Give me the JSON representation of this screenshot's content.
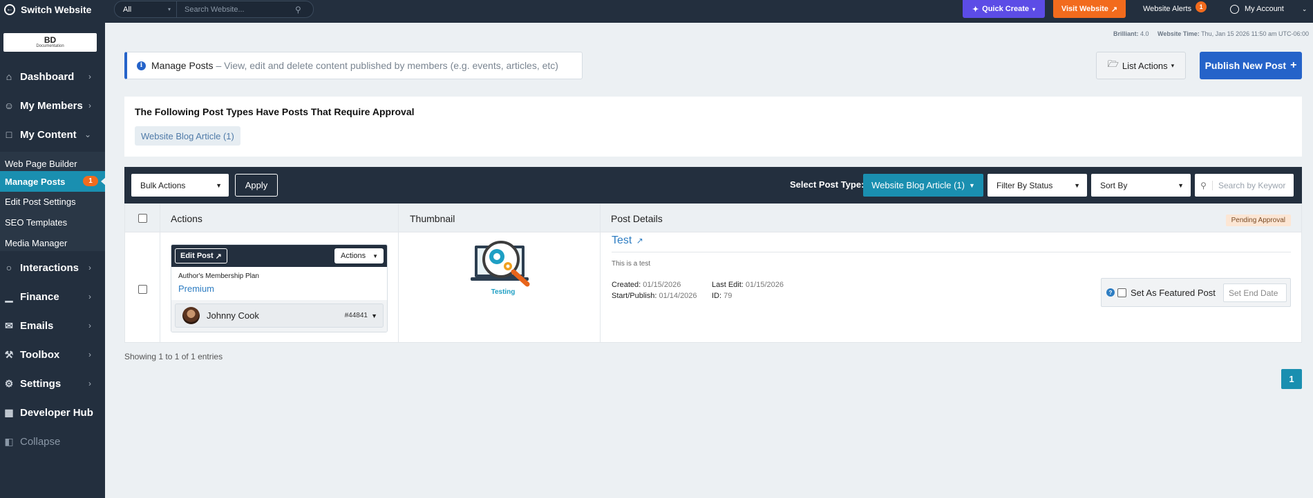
{
  "topbar": {
    "switch_label": "Switch Website",
    "search_scope": "All",
    "search_placeholder": "Search Website...",
    "quick_create": "Quick Create",
    "visit_website": "Visit Website",
    "alerts_label": "Website Alerts",
    "alerts_count": "1",
    "account_label": "My Account"
  },
  "logo": {
    "text": "BD",
    "subtext": "Documentation"
  },
  "sidebar": {
    "items": [
      {
        "label": "Dashboard",
        "icon": "home-icon"
      },
      {
        "label": "My Members",
        "icon": "users-icon"
      },
      {
        "label": "My Content",
        "icon": "folder-icon"
      },
      {
        "label": "Interactions",
        "icon": "chat-icon"
      },
      {
        "label": "Finance",
        "icon": "bar-chart-icon"
      },
      {
        "label": "Emails",
        "icon": "envelope-icon"
      },
      {
        "label": "Toolbox",
        "icon": "wrench-icon"
      },
      {
        "label": "Settings",
        "icon": "gear-icon"
      },
      {
        "label": "Developer Hub",
        "icon": "grid-icon"
      },
      {
        "label": "Collapse",
        "icon": "collapse-icon"
      }
    ],
    "subitems": [
      {
        "label": "Web Page Builder"
      },
      {
        "label": "Manage Posts",
        "badge": "1"
      },
      {
        "label": "Edit Post Settings"
      },
      {
        "label": "SEO Templates"
      },
      {
        "label": "Media Manager"
      }
    ]
  },
  "meta": {
    "brilliant_label": "Brilliant:",
    "brilliant_value": "4.0",
    "time_label": "Website Time:",
    "time_value": "Thu, Jan 15 2026 11:50 am UTC-06:00"
  },
  "header": {
    "title": "Manage Posts",
    "description": "– View, edit and delete content published by members (e.g. events, articles, etc)",
    "list_actions": "List Actions",
    "publish_button": "Publish New Post"
  },
  "approval": {
    "heading": "The Following Post Types Have Posts That Require Approval",
    "chip": "Website Blog Article (1)"
  },
  "filters": {
    "bulk_actions": "Bulk Actions",
    "apply": "Apply",
    "post_type_label": "Select Post Type:",
    "post_type_value": "Website Blog Article (1)",
    "status": "Filter By Status",
    "sort": "Sort By",
    "search_placeholder": "Search by Keywor"
  },
  "table": {
    "columns": [
      "Actions",
      "Thumbnail",
      "Post Details"
    ],
    "rows": [
      {
        "edit_label": "Edit Post",
        "actions_label": "Actions",
        "plan_label": "Author's Membership Plan",
        "plan_value": "Premium",
        "author": "Johnny Cook",
        "author_id": "#44841",
        "thumb_caption": "Testing",
        "status": "Pending Approval",
        "title": "Test",
        "description": "This is a test",
        "created_label": "Created:",
        "created": "01/15/2026",
        "last_edit_label": "Last Edit:",
        "last_edit": "01/15/2026",
        "start_label": "Start/Publish:",
        "start": "01/14/2026",
        "id_label": "ID:",
        "id": "79",
        "featured_label": "Set As Featured Post",
        "end_date_placeholder": "Set End Date"
      }
    ]
  },
  "footer": {
    "showing": "Showing 1 to 1 of 1 entries",
    "page": "1"
  },
  "colors": {
    "nav_bg": "#232f3e",
    "accent_teal": "#1a8fb0",
    "primary_blue": "#2563c9",
    "quick_create_purple": "#5c4ce6",
    "visit_orange": "#f26b1d"
  }
}
